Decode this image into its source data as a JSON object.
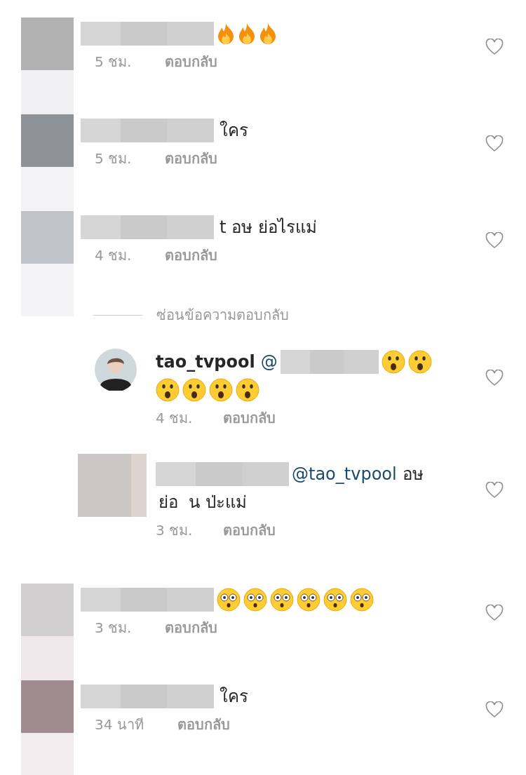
{
  "comments": [
    {
      "kind": "top",
      "body": [
        {
          "kind": "redacted"
        },
        {
          "kind": "fire"
        },
        {
          "kind": "fire"
        },
        {
          "kind": "fire"
        }
      ],
      "time": "5 ชม.",
      "reply": "ตอบกลับ"
    },
    {
      "kind": "top",
      "body": [
        {
          "kind": "redacted"
        },
        {
          "kind": "text",
          "text": "ใคร"
        }
      ],
      "time": "5 ชม.",
      "reply": "ตอบกลับ"
    },
    {
      "kind": "top",
      "body": [
        {
          "kind": "redacted"
        },
        {
          "kind": "text",
          "text": "t อษ ย่อไรแม่"
        }
      ],
      "time": "4 ชม.",
      "reply": "ตอบกลับ"
    },
    {
      "kind": "toggle",
      "text": "ซ่อนข้อความตอบกลับ"
    },
    {
      "kind": "reply",
      "body": [
        {
          "kind": "username",
          "text": "tao_tvpool"
        },
        {
          "kind": "mention",
          "text": "@"
        },
        {
          "kind": "redacted"
        },
        {
          "kind": "astonished"
        },
        {
          "kind": "astonished"
        },
        {
          "kind": "break"
        },
        {
          "kind": "astonished"
        },
        {
          "kind": "astonished"
        },
        {
          "kind": "astonished"
        },
        {
          "kind": "astonished"
        }
      ],
      "time": "4 ชม.",
      "reply": "ตอบกลับ"
    },
    {
      "kind": "reply",
      "avatar": {
        "kind": "hidden"
      },
      "body": [
        {
          "kind": "redacted"
        },
        {
          "kind": "mention",
          "text": "@tao_tvpool"
        },
        {
          "kind": "text",
          "text": "อษ"
        },
        {
          "kind": "break"
        },
        {
          "kind": "text",
          "text": "ย่อ  น ป่ะแม่"
        }
      ],
      "time": "3 ชม.",
      "reply": "ตอบกลับ"
    },
    {
      "kind": "top",
      "body": [
        {
          "kind": "redacted"
        },
        {
          "kind": "flushed"
        },
        {
          "kind": "flushed"
        },
        {
          "kind": "flushed"
        },
        {
          "kind": "flushed"
        },
        {
          "kind": "flushed"
        },
        {
          "kind": "flushed"
        }
      ],
      "time": "3 ชม.",
      "reply": "ตอบกลับ"
    },
    {
      "kind": "top",
      "body": [
        {
          "kind": "redacted"
        },
        {
          "kind": "text",
          "text": "ใคร"
        }
      ],
      "time": "34 นาที",
      "reply": "ตอบกลับ"
    }
  ]
}
